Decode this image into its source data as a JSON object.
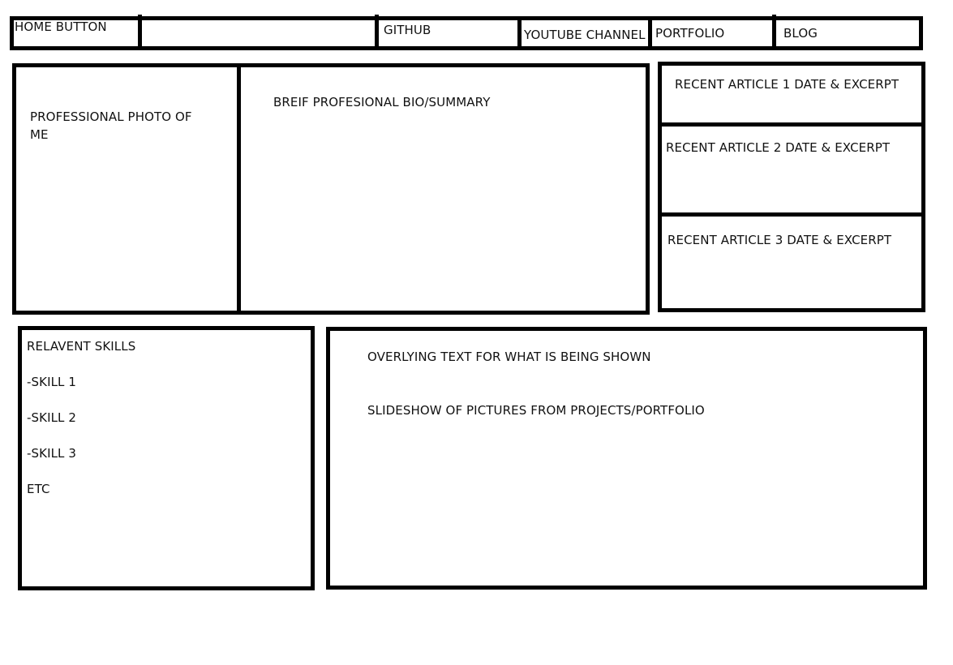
{
  "nav": {
    "home": "HOME BUTTON",
    "github": "GITHUB",
    "youtube": "YOUTUBE CHANNEL",
    "portfolio": "PORTFOLIO",
    "blog": "BLOG"
  },
  "hero": {
    "photo": "PROFESSIONAL PHOTO OF ME",
    "bio": "BREIF PROFESIONAL BIO/SUMMARY"
  },
  "articles": [
    "RECENT ARTICLE 1 DATE & EXCERPT",
    "RECENT ARTICLE 2 DATE & EXCERPT",
    "RECENT ARTICLE 3 DATE & EXCERPT"
  ],
  "skills": {
    "title": "RELAVENT SKILLS",
    "items": [
      "-SKILL 1",
      "-SKILL 2",
      "-SKILL 3",
      "ETC"
    ]
  },
  "slideshow": {
    "overlay": "OVERLYING TEXT FOR WHAT IS BEING SHOWN",
    "caption": "SLIDESHOW OF PICTURES FROM PROJECTS/PORTFOLIO"
  },
  "colors": {
    "line": "#000000",
    "background": "#ffffff"
  }
}
